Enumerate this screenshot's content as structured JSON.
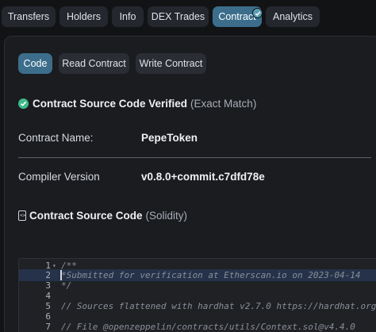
{
  "nav": {
    "tabs": [
      {
        "label": "Transfers"
      },
      {
        "label": "Holders"
      },
      {
        "label": "Info"
      },
      {
        "label": "DEX Trades"
      },
      {
        "label": "Contract"
      },
      {
        "label": "Analytics"
      }
    ],
    "active_tab": "Contract"
  },
  "subtabs": [
    {
      "label": "Code"
    },
    {
      "label": "Read Contract"
    },
    {
      "label": "Write Contract"
    }
  ],
  "active_subtab": "Code",
  "verified": {
    "title": "Contract Source Code Verified",
    "match": "(Exact Match)"
  },
  "contract": {
    "name_label": "Contract Name:",
    "name_value": "PepeToken",
    "compiler_label": "Compiler Version",
    "compiler_value": "v0.8.0+commit.c7dfd78e"
  },
  "source": {
    "title": "Contract Source Code",
    "lang": "(Solidity)"
  },
  "code_lines": [
    {
      "n": "1",
      "text": "/**",
      "fold": "▾"
    },
    {
      "n": "2",
      "text": " *Submitted for verification at Etherscan.io on 2023-04-14"
    },
    {
      "n": "3",
      "text": "*/"
    },
    {
      "n": "4",
      "text": ""
    },
    {
      "n": "5",
      "text": "// Sources flattened with hardhat v2.7.0 https://hardhat.org"
    },
    {
      "n": "6",
      "text": ""
    },
    {
      "n": "7",
      "text": "// File @openzeppelin/contracts/utils/Context.sol@v4.4.0"
    }
  ],
  "colors": {
    "accent": "#3c6e8c",
    "verified_green": "#3fb98a",
    "background": "#121315"
  }
}
